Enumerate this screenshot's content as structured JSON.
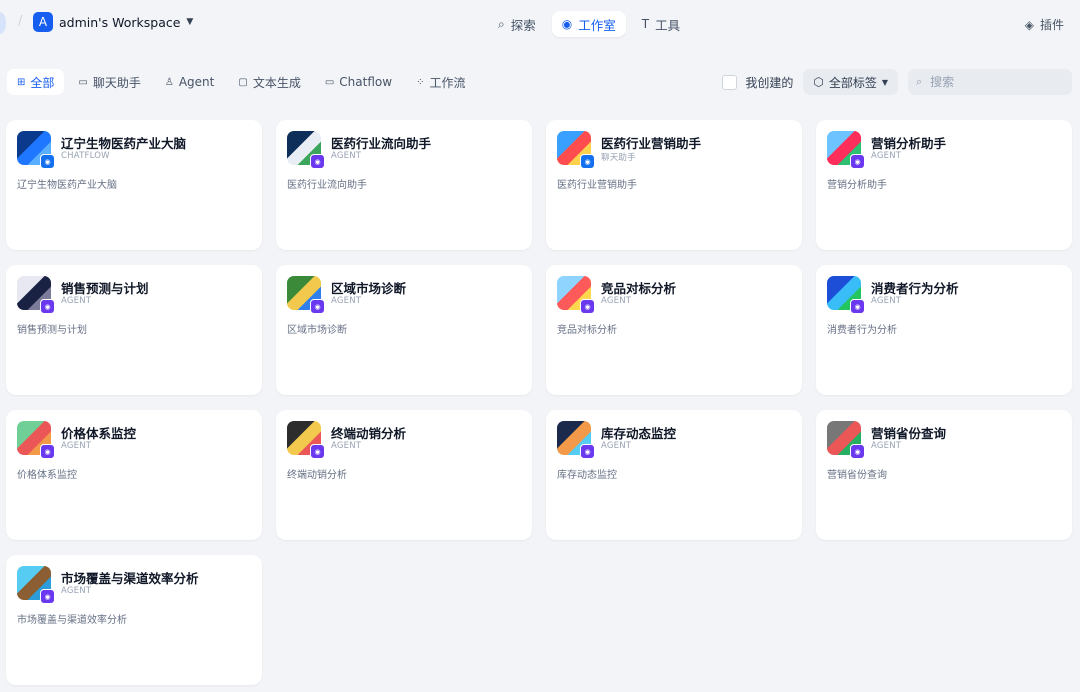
{
  "workspace": {
    "logo_letter": "A",
    "name": "admin's Workspace"
  },
  "nav": [
    {
      "label": "探索",
      "icon": "compass-icon",
      "glyph": "⌕",
      "active": false
    },
    {
      "label": "工作室",
      "icon": "robot-icon",
      "glyph": "◉",
      "active": true
    },
    {
      "label": "工具",
      "icon": "hammer-icon",
      "glyph": "T",
      "active": false
    }
  ],
  "plugin": {
    "label": "插件",
    "icon": "cube-icon"
  },
  "filters": {
    "tabs": [
      {
        "label": "全部",
        "icon": "grid-icon",
        "glyph": "⊞",
        "active": true
      },
      {
        "label": "聊天助手",
        "icon": "chat-icon",
        "glyph": "▭",
        "active": false
      },
      {
        "label": "Agent",
        "icon": "agent-icon",
        "glyph": "♙",
        "active": false
      },
      {
        "label": "文本生成",
        "icon": "document-icon",
        "glyph": "▢",
        "active": false
      },
      {
        "label": "Chatflow",
        "icon": "chatflow-icon",
        "glyph": "▭",
        "active": false
      },
      {
        "label": "工作流",
        "icon": "workflow-icon",
        "glyph": "⁘",
        "active": false
      }
    ],
    "mine_label": "我创建的",
    "tags_label": "全部标签",
    "search_placeholder": "搜索"
  },
  "apps": [
    {
      "title": "辽宁生物医药产业大脑",
      "type": "CHATFLOW",
      "desc": "辽宁生物医药产业大脑",
      "colors": [
        "#0b3a8c",
        "#1f77ff",
        "#5ab0ff"
      ],
      "badge": "chat"
    },
    {
      "title": "医药行业流向助手",
      "type": "AGENT",
      "desc": "医药行业流向助手",
      "colors": [
        "#0e2f5a",
        "#e9eef5",
        "#3ba55c"
      ],
      "badge": "agent"
    },
    {
      "title": "医药行业营销助手",
      "type": "聊天助手",
      "desc": "医药行业营销助手",
      "colors": [
        "#3aa0ff",
        "#ff4d4f",
        "#ffd24d"
      ],
      "badge": "chat"
    },
    {
      "title": "营销分析助手",
      "type": "AGENT",
      "desc": "营销分析助手",
      "colors": [
        "#6cc3ff",
        "#ff2e5b",
        "#2fbf71"
      ],
      "badge": "agent"
    },
    {
      "title": "销售预测与计划",
      "type": "AGENT",
      "desc": "销售预测与计划",
      "colors": [
        "#e8e8f2",
        "#1a2244",
        "#7c7c9a"
      ],
      "badge": "agent"
    },
    {
      "title": "区域市场诊断",
      "type": "AGENT",
      "desc": "区域市场诊断",
      "colors": [
        "#3a8a3a",
        "#f2c94c",
        "#2f80ed"
      ],
      "badge": "agent"
    },
    {
      "title": "竞品对标分析",
      "type": "AGENT",
      "desc": "竞品对标分析",
      "colors": [
        "#8fd3ff",
        "#ff5a5a",
        "#ffd84d"
      ],
      "badge": "agent"
    },
    {
      "title": "消费者行为分析",
      "type": "AGENT",
      "desc": "消费者行为分析",
      "colors": [
        "#1d4ed8",
        "#38bdf8",
        "#22c55e"
      ],
      "badge": "agent"
    },
    {
      "title": "价格体系监控",
      "type": "AGENT",
      "desc": "价格体系监控",
      "colors": [
        "#6fcf97",
        "#eb5757",
        "#f2994a"
      ],
      "badge": "agent"
    },
    {
      "title": "终端动销分析",
      "type": "AGENT",
      "desc": "终端动销分析",
      "colors": [
        "#2d2d2d",
        "#f2c94c",
        "#eb5757"
      ],
      "badge": "agent"
    },
    {
      "title": "库存动态监控",
      "type": "AGENT",
      "desc": "库存动态监控",
      "colors": [
        "#1b2a4a",
        "#f2994a",
        "#56ccf2"
      ],
      "badge": "agent"
    },
    {
      "title": "营销省份查询",
      "type": "AGENT",
      "desc": "营销省份查询",
      "colors": [
        "#777777",
        "#eb5757",
        "#27ae60"
      ],
      "badge": "agent"
    },
    {
      "title": "市场覆盖与渠道效率分析",
      "type": "AGENT",
      "desc": "市场覆盖与渠道效率分析",
      "colors": [
        "#56ccf2",
        "#8b5e34",
        "#2d9cdb"
      ],
      "badge": "agent"
    }
  ]
}
